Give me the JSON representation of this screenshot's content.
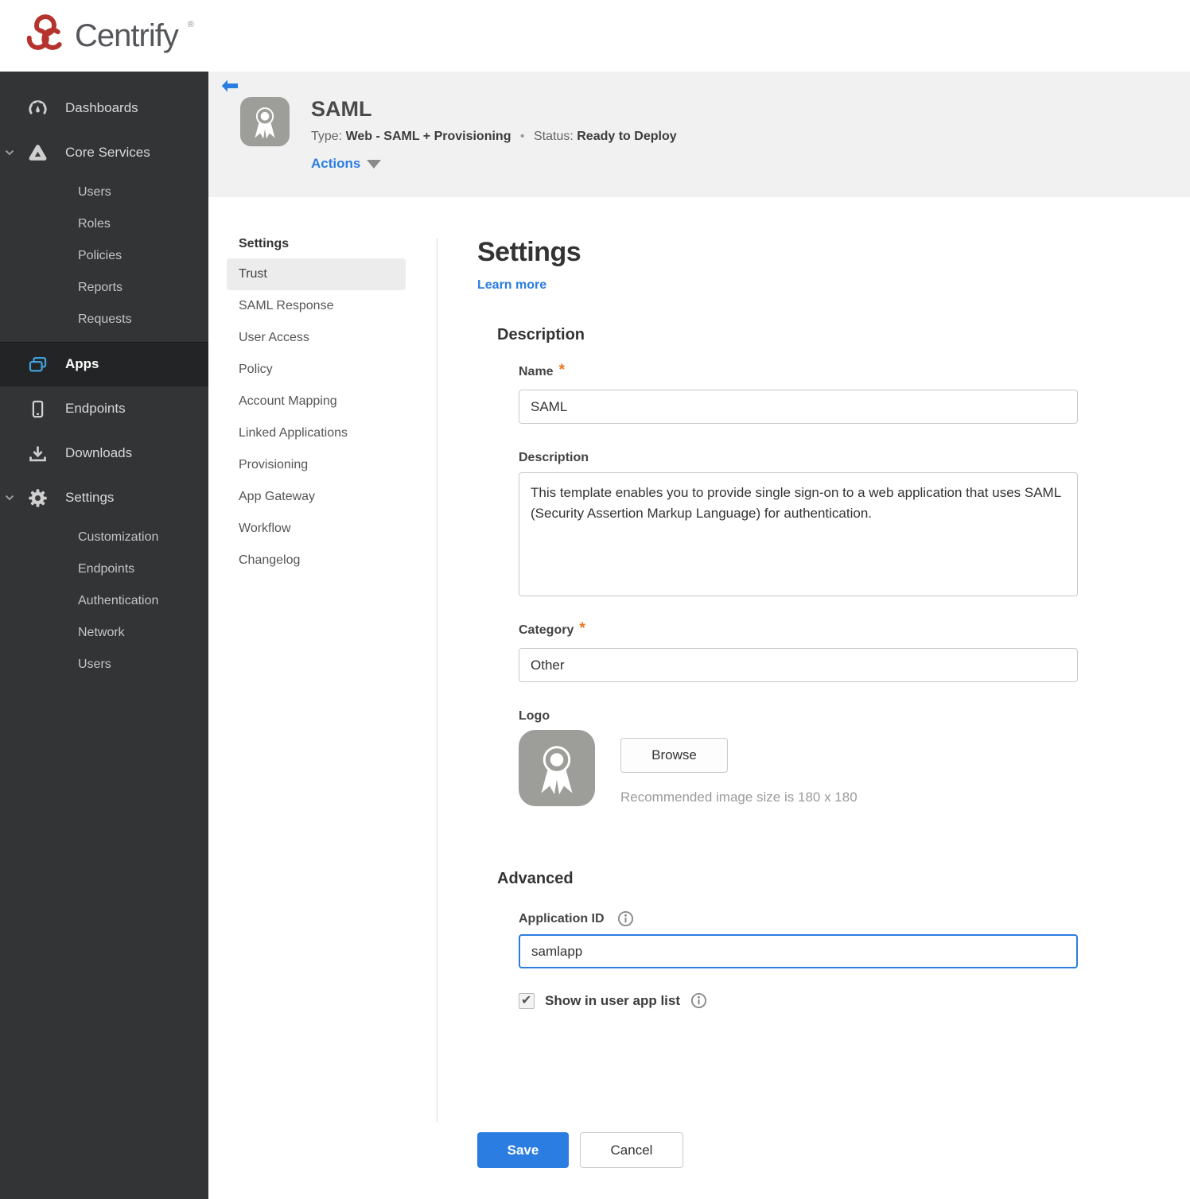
{
  "brand": {
    "name": "Centrify",
    "trademark": "®"
  },
  "sidebar": {
    "items": [
      {
        "label": "Dashboards"
      },
      {
        "label": "Core Services",
        "expanded": true
      },
      {
        "label": "Users"
      },
      {
        "label": "Roles"
      },
      {
        "label": "Policies"
      },
      {
        "label": "Reports"
      },
      {
        "label": "Requests"
      },
      {
        "label": "Apps",
        "active": true
      },
      {
        "label": "Endpoints"
      },
      {
        "label": "Downloads"
      },
      {
        "label": "Settings",
        "expanded": true
      },
      {
        "label": "Customization"
      },
      {
        "label": "Endpoints"
      },
      {
        "label": "Authentication"
      },
      {
        "label": "Network"
      },
      {
        "label": "Users"
      }
    ]
  },
  "app_header": {
    "title": "SAML",
    "type_label": "Type:",
    "type_value": "Web - SAML + Provisioning",
    "separator": "•",
    "status_label": "Status:",
    "status_value": "Ready to Deploy",
    "actions_label": "Actions"
  },
  "subnav": {
    "heading": "Settings",
    "items": [
      {
        "label": "Trust",
        "active": true
      },
      {
        "label": "SAML Response"
      },
      {
        "label": "User Access"
      },
      {
        "label": "Policy"
      },
      {
        "label": "Account Mapping"
      },
      {
        "label": "Linked Applications"
      },
      {
        "label": "Provisioning"
      },
      {
        "label": "App Gateway"
      },
      {
        "label": "Workflow"
      },
      {
        "label": "Changelog"
      }
    ]
  },
  "main": {
    "heading": "Settings",
    "learn_more_label": "Learn more",
    "description_section": {
      "heading": "Description",
      "name_label": "Name",
      "required_marker": "*",
      "name_value": "SAML",
      "description_label": "Description",
      "description_value": "This template enables you to provide single sign-on to a web application that uses SAML (Security Assertion Markup Language) for authentication.",
      "category_label": "Category",
      "category_value": "Other",
      "logo_label": "Logo",
      "browse_label": "Browse",
      "recommended_text": "Recommended image size is 180 x 180"
    },
    "advanced_section": {
      "heading": "Advanced",
      "app_id_label": "Application ID",
      "app_id_value": "samlapp",
      "show_in_app_list_label": "Show in user app list",
      "show_in_app_list_checked": true
    },
    "save_label": "Save",
    "cancel_label": "Cancel"
  },
  "colors": {
    "accent": "#2b7de1",
    "status-red": "#a5281b",
    "brand-red": "#b5322d",
    "apps-blue": "#41a0dd",
    "asterisk-orange": "#e87722"
  }
}
